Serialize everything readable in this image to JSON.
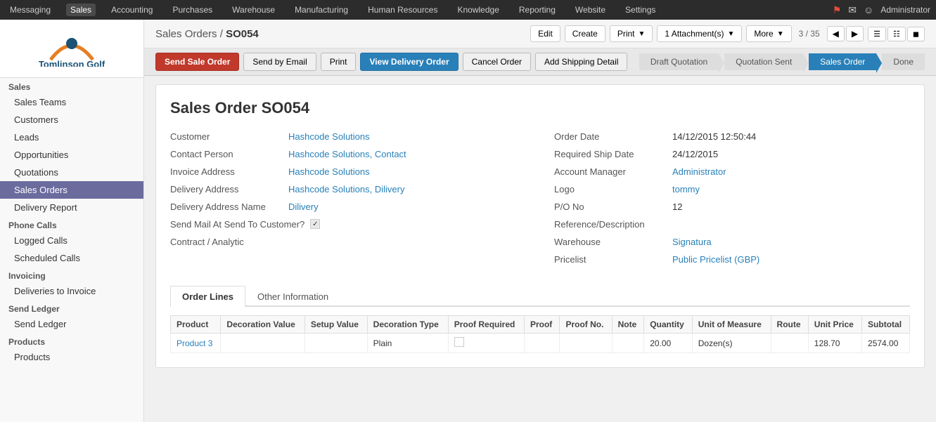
{
  "topnav": {
    "items": [
      "Messaging",
      "Sales",
      "Accounting",
      "Purchases",
      "Warehouse",
      "Manufacturing",
      "Human Resources",
      "Knowledge",
      "Reporting",
      "Website",
      "Settings"
    ],
    "active": "Sales",
    "right": [
      "notification-icon",
      "message-icon",
      "avatar",
      "Administrator"
    ]
  },
  "breadcrumb": {
    "parent": "Sales Orders",
    "separator": "/",
    "current": "SO054"
  },
  "header": {
    "edit_label": "Edit",
    "create_label": "Create",
    "print_label": "Print",
    "attachments_label": "1 Attachment(s)",
    "more_label": "More",
    "counter": "3 / 35",
    "views": [
      "list-icon",
      "kanban-icon",
      "calendar-icon"
    ]
  },
  "action_buttons": {
    "send_sale_order": "Send Sale Order",
    "send_by_email": "Send by Email",
    "print": "Print",
    "view_delivery_order": "View Delivery Order",
    "cancel_order": "Cancel Order",
    "add_shipping_detail": "Add Shipping Detail"
  },
  "workflow": {
    "steps": [
      {
        "label": "Draft Quotation",
        "active": false
      },
      {
        "label": "Quotation Sent",
        "active": false
      },
      {
        "label": "Sales Order",
        "active": true
      },
      {
        "label": "Done",
        "active": false
      }
    ]
  },
  "document": {
    "title": "Sales Order SO054",
    "left_fields": [
      {
        "label": "Customer",
        "value": "Hashcode Solutions",
        "is_link": true
      },
      {
        "label": "Contact Person",
        "value": "Hashcode Solutions, Contact",
        "is_link": true
      },
      {
        "label": "Invoice Address",
        "value": "Hashcode Solutions",
        "is_link": true
      },
      {
        "label": "Delivery Address",
        "value": "Hashcode Solutions, Dilivery",
        "is_link": true
      },
      {
        "label": "Delivery Address Name",
        "value": "Dilivery",
        "is_link": true
      },
      {
        "label": "Send Mail At Send To Customer?",
        "value": "checked",
        "is_checkbox": true
      },
      {
        "label": "Contract / Analytic",
        "value": "",
        "is_link": false
      }
    ],
    "right_fields": [
      {
        "label": "Order Date",
        "value": "14/12/2015 12:50:44",
        "is_link": false
      },
      {
        "label": "Required Ship Date",
        "value": "24/12/2015",
        "is_link": false
      },
      {
        "label": "Account Manager",
        "value": "Administrator",
        "is_link": true
      },
      {
        "label": "Logo",
        "value": "tommy",
        "is_link": true
      },
      {
        "label": "P/O No",
        "value": "12",
        "is_link": false
      },
      {
        "label": "Reference/Description",
        "value": "",
        "is_link": false
      },
      {
        "label": "Warehouse",
        "value": "Signatura",
        "is_link": true
      },
      {
        "label": "Pricelist",
        "value": "Public Pricelist (GBP)",
        "is_link": true
      }
    ]
  },
  "tabs": {
    "items": [
      "Order Lines",
      "Other Information"
    ],
    "active": "Order Lines"
  },
  "table": {
    "headers": [
      "Product",
      "Decoration Value",
      "Setup Value",
      "Decoration Type",
      "Proof Required",
      "Proof",
      "Proof No.",
      "Note",
      "Quantity",
      "Unit of Measure",
      "Route",
      "Unit Price",
      "Subtotal"
    ],
    "rows": [
      {
        "product": "Product 3",
        "decoration_value": "",
        "setup_value": "",
        "decoration_type": "Plain",
        "proof_required": false,
        "proof": "",
        "proof_no": "",
        "note": "",
        "quantity": "20.00",
        "unit_of_measure": "Dozen(s)",
        "route": "",
        "unit_price": "128.70",
        "subtotal": "2574.00"
      }
    ]
  },
  "sidebar": {
    "logo_line1": "Tomlinson",
    "logo_line2": "Golf",
    "sections": [
      {
        "label": "Sales",
        "items": [
          {
            "label": "Sales Teams",
            "active": false
          },
          {
            "label": "Customers",
            "active": false
          },
          {
            "label": "Leads",
            "active": false
          },
          {
            "label": "Opportunities",
            "active": false
          },
          {
            "label": "Quotations",
            "active": false
          },
          {
            "label": "Sales Orders",
            "active": true
          },
          {
            "label": "Delivery Report",
            "active": false
          }
        ]
      },
      {
        "label": "Phone Calls",
        "items": [
          {
            "label": "Logged Calls",
            "active": false
          },
          {
            "label": "Scheduled Calls",
            "active": false
          }
        ]
      },
      {
        "label": "Invoicing",
        "items": [
          {
            "label": "Deliveries to Invoice",
            "active": false
          }
        ]
      },
      {
        "label": "Send Ledger",
        "items": [
          {
            "label": "Send Ledger",
            "active": false
          }
        ]
      },
      {
        "label": "Products",
        "items": [
          {
            "label": "Products",
            "active": false
          }
        ]
      }
    ]
  }
}
